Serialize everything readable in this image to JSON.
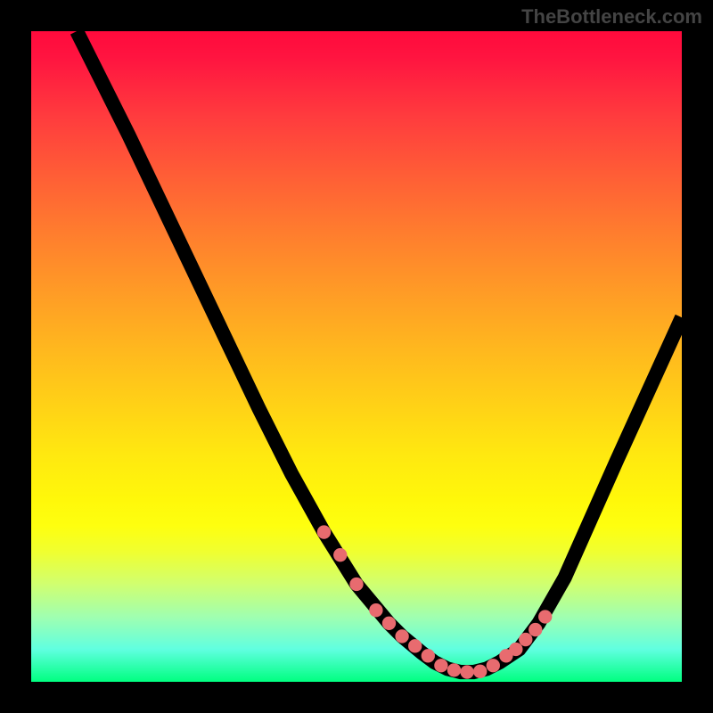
{
  "watermark": "TheBottleneck.com",
  "chart_data": {
    "type": "line",
    "title": "",
    "xlabel": "",
    "ylabel": "",
    "xlim": [
      0,
      100
    ],
    "ylim": [
      0,
      100
    ],
    "grid": false,
    "series": [
      {
        "name": "curve",
        "x": [
          7,
          10,
          15,
          20,
          25,
          30,
          35,
          40,
          45,
          50,
          55,
          57,
          60,
          62,
          64,
          66,
          68,
          70,
          72,
          75,
          78,
          82,
          86,
          90,
          95,
          100
        ],
        "y": [
          100,
          94,
          84,
          73.5,
          63,
          52.5,
          42,
          32,
          23,
          15,
          9,
          7,
          4.5,
          3,
          2,
          1.5,
          1.5,
          2,
          3,
          5,
          9,
          16,
          25,
          34,
          45,
          56
        ]
      }
    ],
    "scatter_points": {
      "name": "markers",
      "x": [
        45,
        47.5,
        50,
        53,
        55,
        57,
        59,
        61,
        63,
        65,
        67,
        69,
        71,
        73,
        74.5,
        76,
        77.5,
        79
      ],
      "y": [
        23,
        19.5,
        15,
        11,
        9,
        7,
        5.5,
        4,
        2.5,
        1.8,
        1.5,
        1.6,
        2.5,
        4,
        5,
        6.5,
        8,
        10
      ]
    },
    "background": {
      "type": "vertical-gradient",
      "stops": [
        {
          "pos": 0.0,
          "color": "#ff0a3c"
        },
        {
          "pos": 0.25,
          "color": "#ff6a32"
        },
        {
          "pos": 0.5,
          "color": "#ffd316"
        },
        {
          "pos": 0.75,
          "color": "#feff0f"
        },
        {
          "pos": 1.0,
          "color": "#00ff80"
        }
      ]
    }
  }
}
